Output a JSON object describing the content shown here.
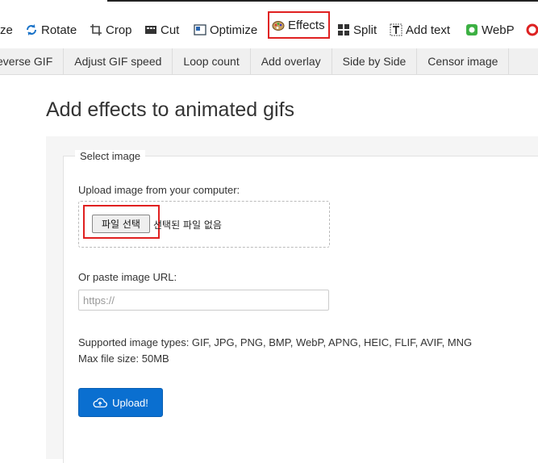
{
  "toolbar": {
    "items": [
      {
        "label": "ze",
        "icon": "resize-icon"
      },
      {
        "label": "Rotate",
        "icon": "rotate-icon"
      },
      {
        "label": "Crop",
        "icon": "crop-icon"
      },
      {
        "label": "Cut",
        "icon": "cut-icon"
      },
      {
        "label": "Optimize",
        "icon": "optimize-icon"
      },
      {
        "label": "Effects",
        "icon": "effects-icon"
      },
      {
        "label": "Split",
        "icon": "split-icon"
      },
      {
        "label": "Add text",
        "icon": "add-text-icon"
      },
      {
        "label": "WebP",
        "icon": "webp-icon"
      }
    ],
    "highlight_color": "#e02020"
  },
  "subnav": {
    "items": [
      "everse GIF",
      "Adjust GIF speed",
      "Loop count",
      "Add overlay",
      "Side by Side",
      "Censor image"
    ]
  },
  "page": {
    "title": "Add effects to animated gifs"
  },
  "form": {
    "legend": "Select image",
    "upload_label": "Upload image from your computer:",
    "file_button": "파일 선택",
    "no_file": "선택된 파일 없음",
    "url_label": "Or paste image URL:",
    "url_placeholder": "https://",
    "supported": "Supported image types: GIF, JPG, PNG, BMP, WebP, APNG, HEIC, FLIF, AVIF, MNG",
    "max_size": "Max file size: 50MB",
    "upload_button": "Upload!",
    "upload_button_color": "#0a6fd0"
  }
}
